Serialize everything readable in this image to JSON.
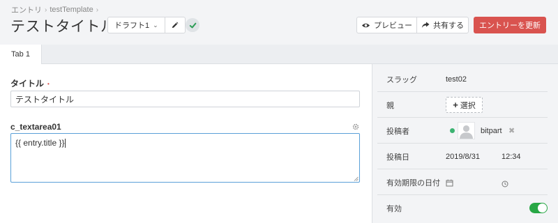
{
  "breadcrumb": {
    "items": [
      "エントリ",
      "testTemplate"
    ],
    "separator": "›"
  },
  "header": {
    "title": "テストタイトル",
    "draft_label": "ドラフト1",
    "preview_label": "プレビュー",
    "share_label": "共有する",
    "update_label": "エントリーを更新",
    "accent_color": "#d9534f",
    "icons": {
      "edit": "pencil-icon",
      "status": "check-icon",
      "preview": "eye-icon",
      "share": "share-arrow-icon"
    }
  },
  "tabs": [
    {
      "label": "Tab 1",
      "active": true
    }
  ],
  "main": {
    "title_field": {
      "label": "タイトル",
      "required_mark": "•",
      "value": "テストタイトル"
    },
    "textarea_field": {
      "label": "c_textarea01",
      "value": "{{ entry.title }}"
    }
  },
  "side": {
    "slug": {
      "label": "スラッグ",
      "value": "test02"
    },
    "parent": {
      "label": "親",
      "button_label": "選択",
      "button_icon": "+"
    },
    "author": {
      "label": "投稿者",
      "name": "bitpart",
      "remove_icon": "✖",
      "status_color": "#3cb371"
    },
    "post_date": {
      "label": "投稿日",
      "date": "2019/8/31",
      "time": "12:34"
    },
    "expiry": {
      "label": "有効期限の日付"
    },
    "enabled": {
      "label": "有効",
      "on": true,
      "color": "#28a745"
    }
  }
}
